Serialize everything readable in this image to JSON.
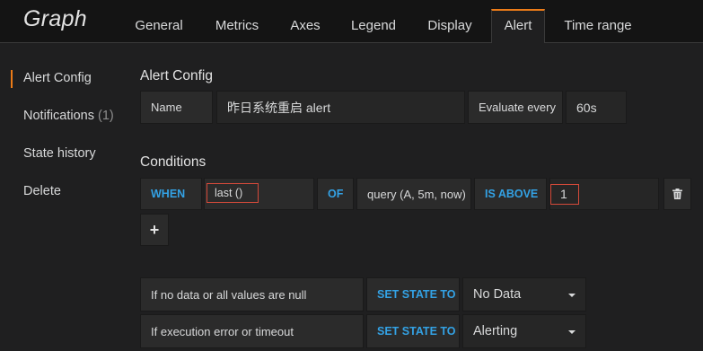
{
  "panel": {
    "title": "Graph"
  },
  "tabs": [
    {
      "label": "General"
    },
    {
      "label": "Metrics"
    },
    {
      "label": "Axes"
    },
    {
      "label": "Legend"
    },
    {
      "label": "Display"
    },
    {
      "label": "Alert"
    },
    {
      "label": "Time range"
    }
  ],
  "active_tab": "Alert",
  "sidebar": {
    "items": [
      {
        "label": "Alert Config"
      },
      {
        "label": "Notifications",
        "count": "(1)"
      },
      {
        "label": "State history"
      },
      {
        "label": "Delete"
      }
    ]
  },
  "alert_config": {
    "heading": "Alert Config",
    "name_label": "Name",
    "name_value": "昨日系统重启 alert",
    "evaluate_label": "Evaluate every",
    "evaluate_value": "60s"
  },
  "conditions": {
    "heading": "Conditions",
    "when_label": "WHEN",
    "reducer": "last ()",
    "of_label": "OF",
    "query": "query (A, 5m, now)",
    "evaluator": "IS ABOVE",
    "threshold": "1",
    "trash_icon": "trash-icon",
    "add_label": "+"
  },
  "no_data": {
    "label": "If no data or all values are null",
    "action": "SET STATE TO",
    "value": "No Data"
  },
  "exec_error": {
    "label": "If execution error or timeout",
    "action": "SET STATE TO",
    "value": "Alerting"
  },
  "colors": {
    "accent": "#eb7b18",
    "keyword": "#33a2e5",
    "highlight": "#d44a3a"
  }
}
